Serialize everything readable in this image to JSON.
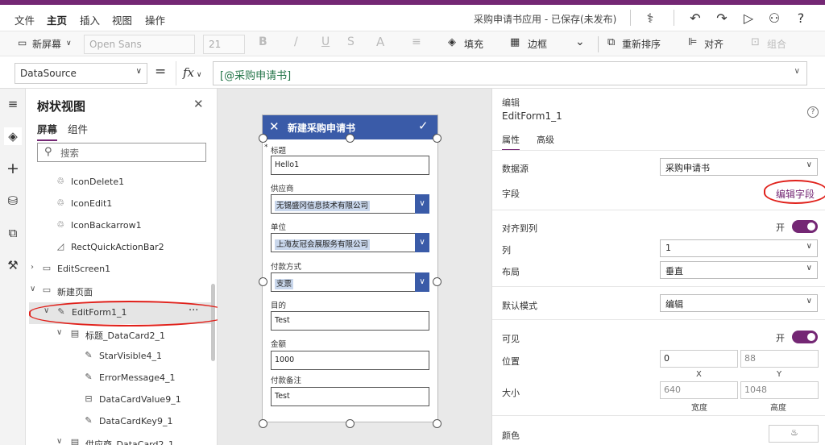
{
  "menu": {
    "items": [
      "文件",
      "主页",
      "插入",
      "视图",
      "操作"
    ],
    "app_status": "采购申请书应用 - 已保存(未发布)"
  },
  "ribbon": {
    "new_screen": "新屏幕",
    "font": "Open Sans",
    "font_size": "21",
    "bold": "B",
    "italic": "/",
    "underline": "U",
    "fill": "填充",
    "border": "边框",
    "reorder": "重新排序",
    "align": "对齐",
    "group": "组合"
  },
  "formula": {
    "property": "DataSource",
    "eq": "=",
    "fx": "fx",
    "value": "[@采购申请书]"
  },
  "tree": {
    "title": "树状视图",
    "tabs": [
      "屏幕",
      "组件"
    ],
    "search_placeholder": "搜索",
    "nodes": [
      "IconDelete1",
      "IconEdit1",
      "IconBackarrow1",
      "RectQuickActionBar2",
      "EditScreen1",
      "新建页面",
      "EditForm1_1",
      "标题_DataCard2_1",
      "StarVisible4_1",
      "ErrorMessage4_1",
      "DataCardValue9_1",
      "DataCardKey9_1",
      "供应商_DataCard2_1"
    ],
    "more": "···"
  },
  "form": {
    "header": "新建采购申请书",
    "fields": [
      {
        "label": "标题",
        "value": "Hello1"
      },
      {
        "label": "供应商",
        "value": "无锡盛冈信息技术有限公司"
      },
      {
        "label": "单位",
        "value": "上海友冠会展服务有限公司"
      },
      {
        "label": "付款方式",
        "value": "支票"
      },
      {
        "label": "目的",
        "value": "Test"
      },
      {
        "label": "金额",
        "value": "1000"
      },
      {
        "label": "付款备注",
        "value": "Test"
      }
    ],
    "required_mark": "*"
  },
  "props": {
    "section": "编辑",
    "control": "EditForm1_1",
    "tabs": [
      "属性",
      "高级"
    ],
    "datasource_label": "数据源",
    "datasource_value": "采购申请书",
    "fields_label": "字段",
    "edit_fields": "编辑字段",
    "snap_label": "对齐到列",
    "on": "开",
    "columns_label": "列",
    "columns_value": "1",
    "layout_label": "布局",
    "layout_value": "垂直",
    "default_mode_label": "默认模式",
    "default_mode_value": "编辑",
    "visible_label": "可见",
    "position_label": "位置",
    "pos_x": "0",
    "pos_y": "88",
    "x_label": "X",
    "y_label": "Y",
    "size_label": "大小",
    "width": "640",
    "height": "1048",
    "width_label": "宽度",
    "height_label": "高度",
    "color_label": "颜色"
  },
  "colors": {
    "accent": "#742774",
    "form_header": "#3a5ba8",
    "highlight": "#e0211b"
  }
}
